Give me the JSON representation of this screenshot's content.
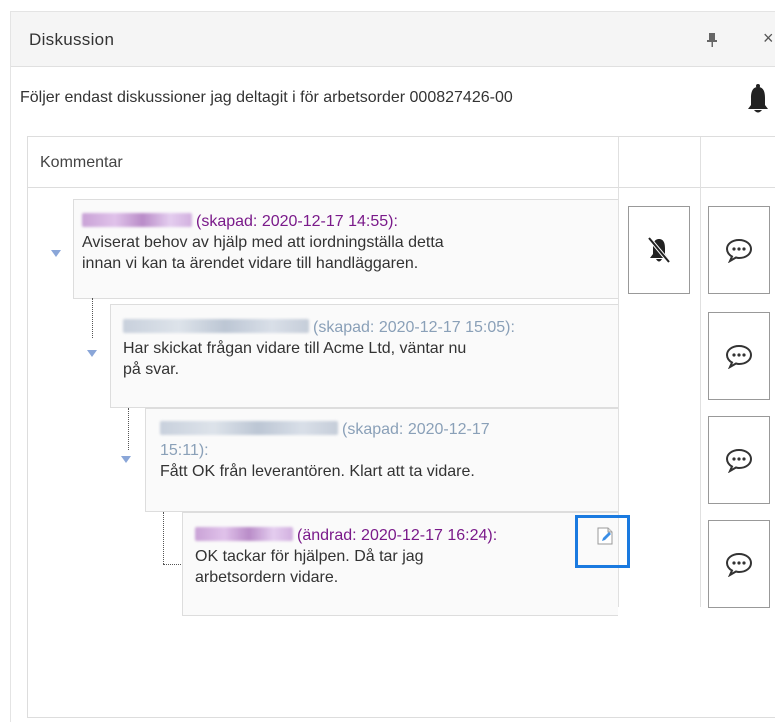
{
  "panel": {
    "title": "Diskussion",
    "pin_icon": "pin-icon",
    "close_icon": "close-icon",
    "close_glyph": "×"
  },
  "follow": {
    "text": "Följer endast diskussioner jag deltagit i för arbetsorder 000827426-00",
    "bell_icon": "bell-icon"
  },
  "grid": {
    "column_header": "Kommentar"
  },
  "comments": [
    {
      "author_redacted": true,
      "meta": "(skapad: 2020-12-17 14:55):",
      "text": "Aviserat behov av hjälp med att iordningställa detta innan vi kan ta ärendet vidare till handläggaren.",
      "meta_color": "#7a1a8a"
    },
    {
      "author_redacted": true,
      "meta": "(skapad: 2020-12-17 15:05):",
      "text": "Har skickat frågan vidare till Acme Ltd, väntar nu på svar.",
      "meta_color": "#8aa0b8"
    },
    {
      "author_redacted": true,
      "meta": "(skapad: 2020-12-17",
      "meta_line2": "15:11):",
      "text": "Fått OK från leverantören. Klart att ta vidare.",
      "meta_color": "#8aa0b8"
    },
    {
      "author_redacted": true,
      "meta": "(ändrad: 2020-12-17 16:24):",
      "text_line1": "OK tackar för hjälpen. Då tar jag",
      "text_line2": "arbetsordern vidare.",
      "meta_color": "#7a1a8a"
    }
  ],
  "comment_lines": {
    "c1_line1": "Aviserat behov av hjälp med att iordningställa detta",
    "c1_line2": "innan vi kan ta ärendet vidare till handläggaren.",
    "c2_line1": "Har skickat frågan vidare till Acme Ltd, väntar nu",
    "c2_line2": "på svar."
  },
  "actions": {
    "mute_icon": "bell-slash-icon",
    "reply_icon": "speech-bubble-icon",
    "edit_icon": "edit-note-icon"
  },
  "colors": {
    "highlight": "#1a7ae0",
    "caret": "#8aa6d8",
    "purple": "#7a1a8a",
    "grey_meta": "#8aa0b8"
  }
}
